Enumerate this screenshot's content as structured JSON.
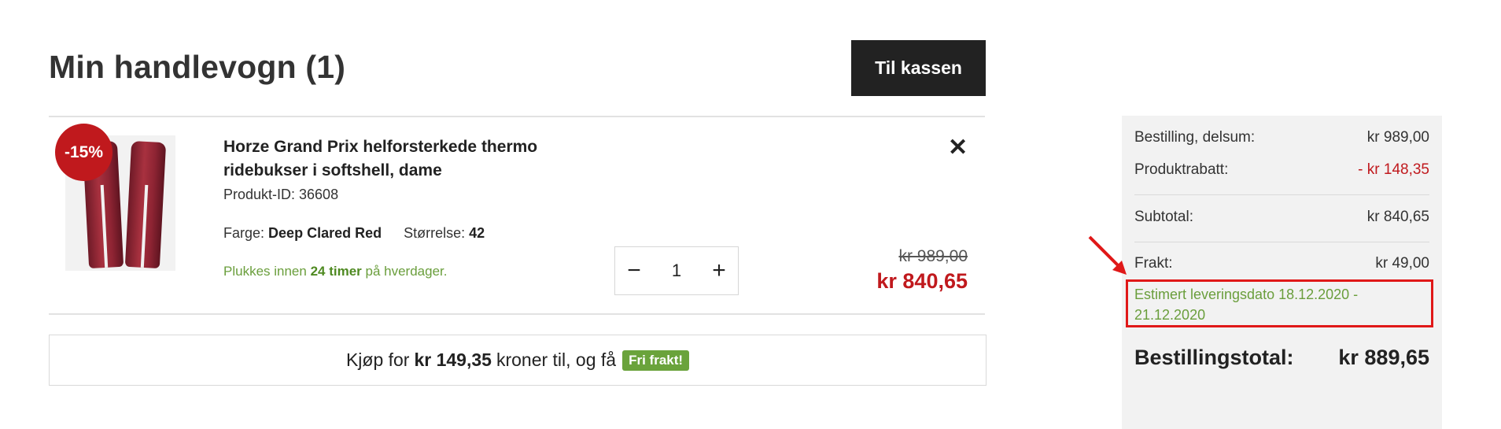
{
  "cart": {
    "title": "Min handlevogn (1)",
    "checkout_label": "Til kassen"
  },
  "item": {
    "discount_badge": "-15%",
    "name": "Horze Grand Prix helforsterkede thermo ridebukser i softshell, dame",
    "product_id": "Produkt-ID: 36608",
    "color_label": "Farge:",
    "color_value": "Deep Clared Red",
    "size_label": "Størrelse:",
    "size_value": "42",
    "pick_prefix": "Plukkes innen",
    "pick_bold": "24 timer",
    "pick_suffix": "på hverdager.",
    "quantity": "1",
    "minus": "−",
    "plus": "+",
    "remove": "✕",
    "old_price": "kr 989,00",
    "new_price": "kr 840,65",
    "image_icon": "pants-icon"
  },
  "shipping_banner": {
    "prefix": "Kjøp for",
    "amount": "kr 149,35",
    "suffix": "kroner til, og få",
    "badge": "Fri frakt!"
  },
  "summary": {
    "subtotal_order_label": "Bestilling, delsum:",
    "subtotal_order_value": "kr 989,00",
    "discount_label": "Produktrabatt:",
    "discount_value": "- kr 148,35",
    "subtotal_label": "Subtotal:",
    "subtotal_value": "kr 840,65",
    "shipping_label": "Frakt:",
    "shipping_value": "kr 49,00",
    "estimate": "Estimert leveringsdato 18.12.2020 - 21.12.2020",
    "total_label": "Bestillingstotal:",
    "total_value": "kr 889,65"
  },
  "colors": {
    "accent_red": "#c0191d",
    "green": "#6aa33b",
    "annotation_red": "#e01818"
  }
}
